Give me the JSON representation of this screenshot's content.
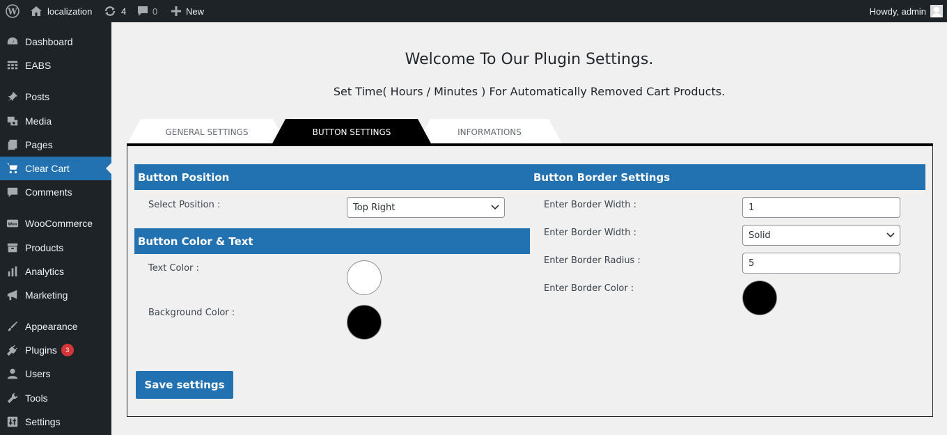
{
  "adminbar": {
    "site_name": "localization",
    "updates_count": "4",
    "comments_count": "0",
    "new_label": "New",
    "howdy": "Howdy, admin"
  },
  "sidebar": {
    "items": [
      {
        "label": "Dashboard",
        "icon": "dashboard-icon"
      },
      {
        "label": "EABS",
        "icon": "grid-icon"
      },
      {
        "label": "Posts",
        "icon": "pin-icon"
      },
      {
        "label": "Media",
        "icon": "media-icon"
      },
      {
        "label": "Pages",
        "icon": "pages-icon"
      },
      {
        "label": "Clear Cart",
        "icon": "cart-icon",
        "current": true
      },
      {
        "label": "Comments",
        "icon": "comment-icon"
      },
      {
        "label": "WooCommerce",
        "icon": "woo-icon"
      },
      {
        "label": "Products",
        "icon": "archive-icon"
      },
      {
        "label": "Analytics",
        "icon": "chart-icon"
      },
      {
        "label": "Marketing",
        "icon": "megaphone-icon"
      },
      {
        "label": "Appearance",
        "icon": "brush-icon"
      },
      {
        "label": "Plugins",
        "icon": "plugin-icon",
        "badge": "3"
      },
      {
        "label": "Users",
        "icon": "user-icon"
      },
      {
        "label": "Tools",
        "icon": "wrench-icon"
      },
      {
        "label": "Settings",
        "icon": "sliders-icon"
      }
    ]
  },
  "main": {
    "title": "Welcome To Our Plugin Settings.",
    "subtitle": "Set Time( Hours / Minutes ) For Automatically Removed Cart Products.",
    "tabs": [
      {
        "label": "GENERAL SETTINGS",
        "active": false
      },
      {
        "label": "BUTTON SETTINGS",
        "active": true
      },
      {
        "label": "INFORMATIONS",
        "active": false
      }
    ]
  },
  "button_position": {
    "header": "Button Position",
    "label": "Select Position :",
    "value": "Top Right"
  },
  "button_color": {
    "header": "Button Color & Text",
    "text_color_label": "Text Color :",
    "text_color": "#ffffff",
    "bg_color_label": "Background Color :",
    "bg_color": "#000000"
  },
  "button_border": {
    "header": "Button Border Settings",
    "width_label": "Enter Border Width :",
    "width_value": "1",
    "style_label": "Enter Border Width :",
    "style_value": "Solid",
    "radius_label": "Enter Border Radius :",
    "radius_value": "5",
    "color_label": "Enter Border Color :",
    "color": "#000000"
  },
  "save_label": "Save settings",
  "colors": {
    "accent": "#2271b1",
    "adminbar": "#1d2327",
    "badge": "#d63638"
  }
}
